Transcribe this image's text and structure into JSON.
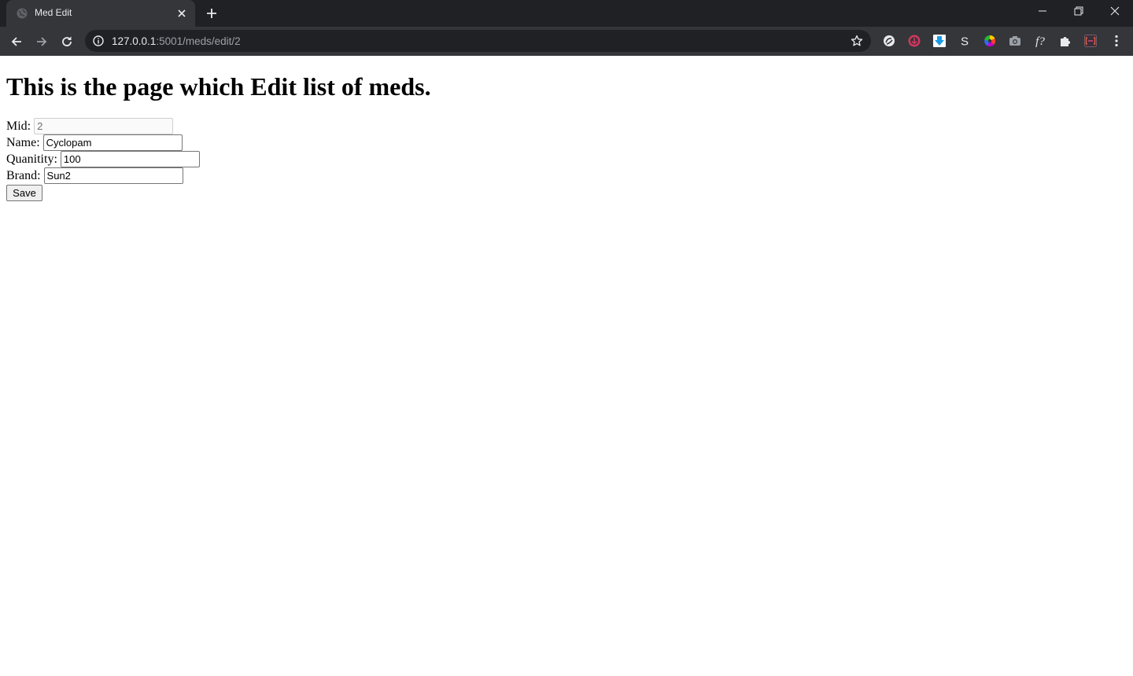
{
  "browser": {
    "tab": {
      "title": "Med Edit"
    },
    "address": {
      "host": "127.0.0.1",
      "path": ":5001/meds/edit/2"
    },
    "colors": {
      "tabstrip": "#202124",
      "toolbar": "#35363a",
      "omnibox": "#202124"
    },
    "extensions": [
      "grammar-extension-icon",
      "download-helper-icon",
      "download-arrow-icon",
      "s-extension-icon",
      "color-wheel-icon",
      "camera-icon",
      "font-finder-icon",
      "extensions-puzzle-icon",
      "code-extension-icon"
    ]
  },
  "page": {
    "title": "This is the page which Edit list of meds.",
    "form": {
      "mid": {
        "label": "Mid:",
        "value": "2"
      },
      "name": {
        "label": "Name:",
        "value": "Cyclopam"
      },
      "quantity": {
        "label": "Quanitity:",
        "value": "100"
      },
      "brand": {
        "label": "Brand:",
        "value": "Sun2"
      },
      "save_label": "Save"
    }
  }
}
